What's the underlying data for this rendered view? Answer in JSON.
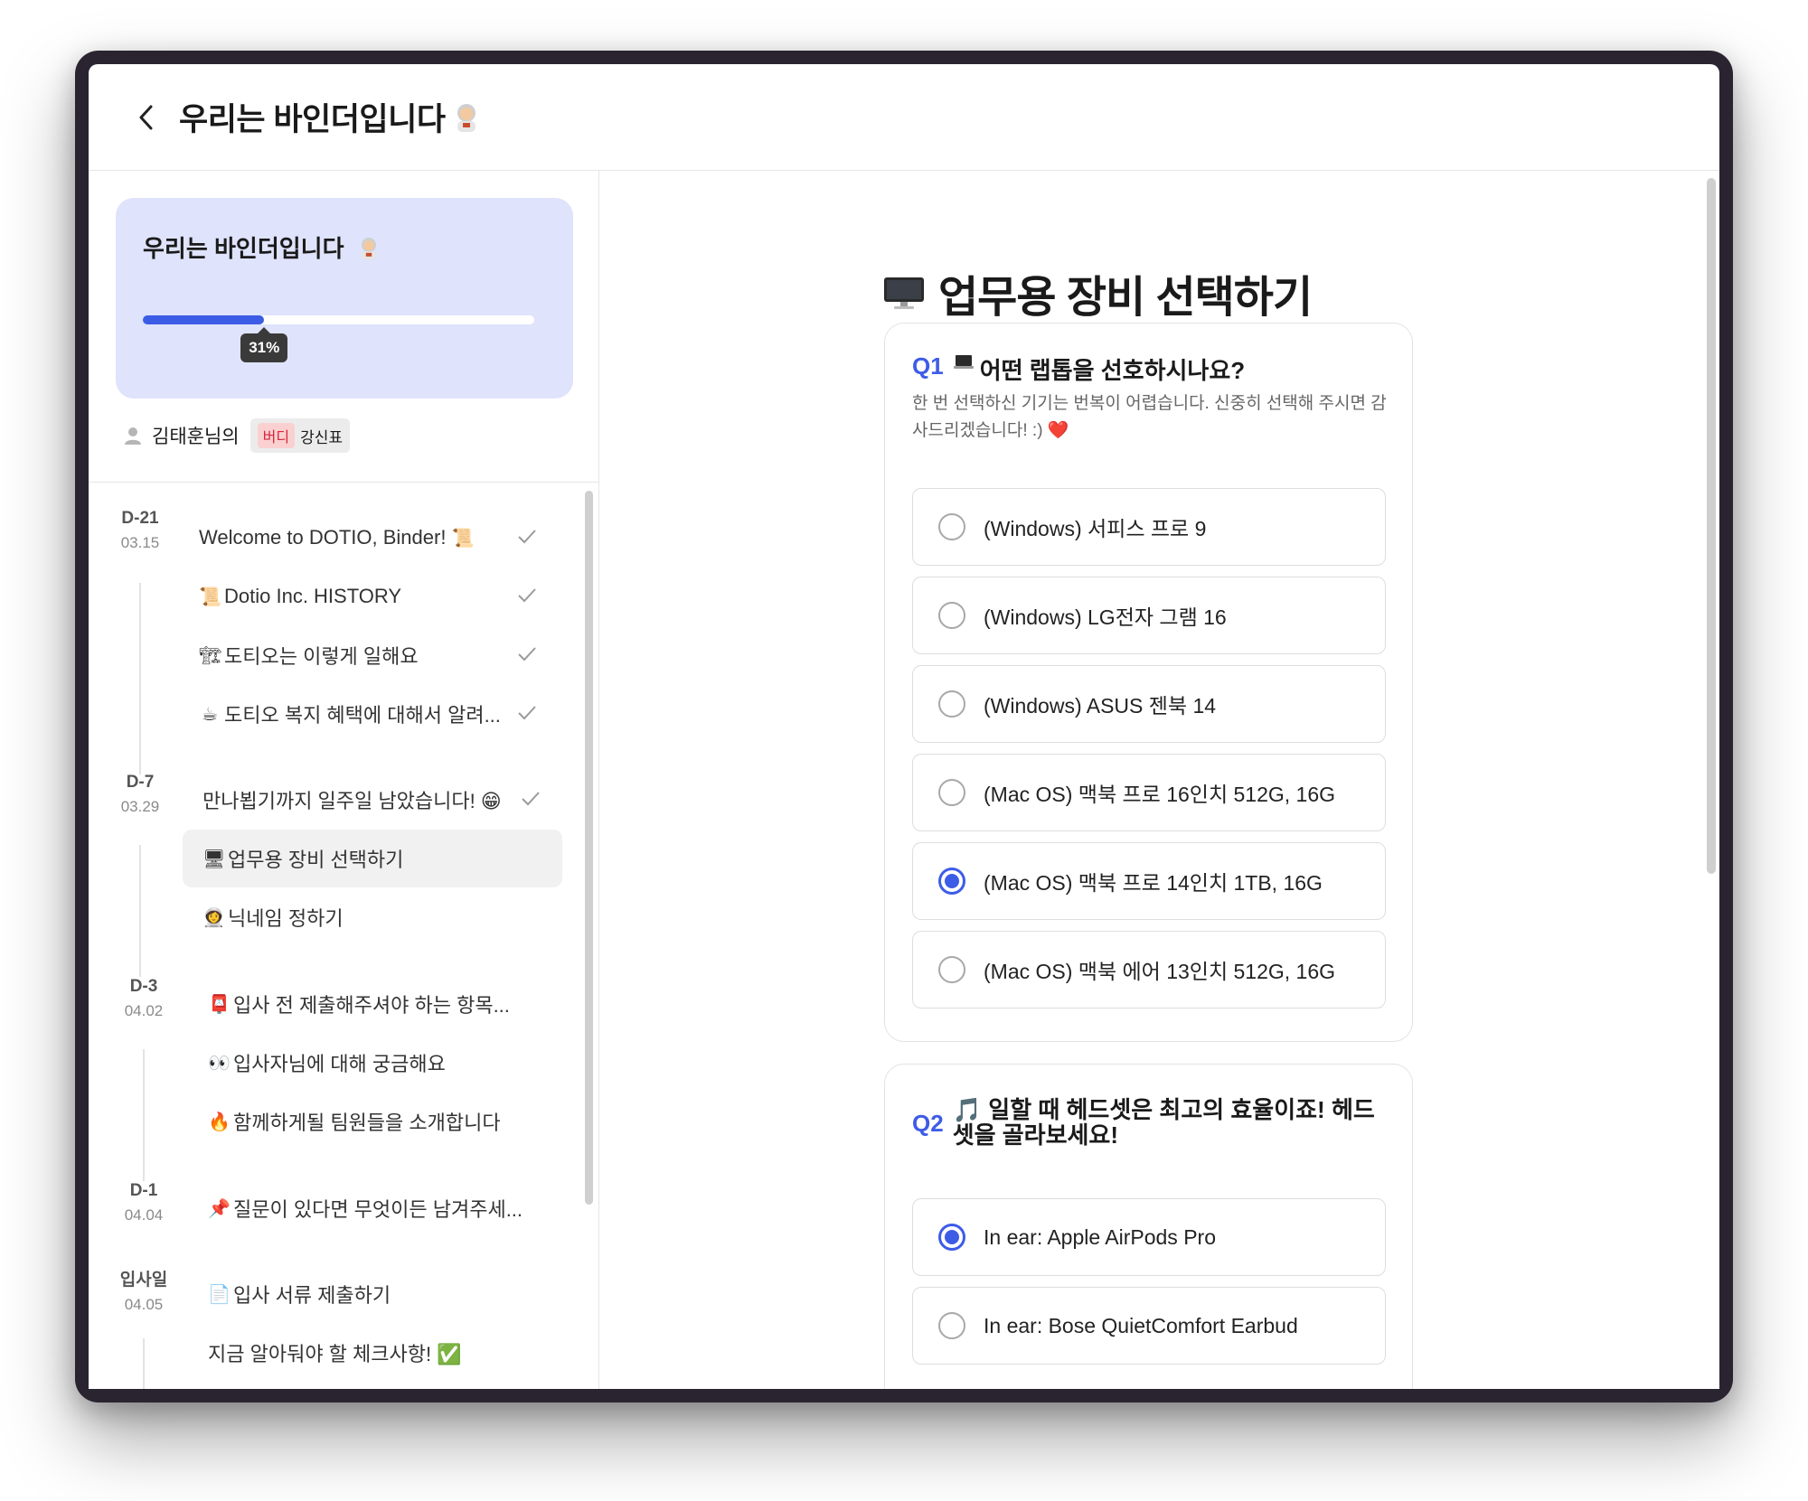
{
  "header": {
    "title": "우리는 바인더입니다"
  },
  "progress": {
    "title": "우리는 바인더입니다",
    "percent": 31,
    "percent_label": "31%"
  },
  "owner": {
    "name": "김태훈님의",
    "buddy_tag": "버디",
    "buddy_name": "강신표"
  },
  "timeline": {
    "days": [
      {
        "d": "D-21",
        "date": "03.15"
      },
      {
        "d": "D-7",
        "date": "03.29"
      },
      {
        "d": "D-3",
        "date": "04.02"
      },
      {
        "d": "D-1",
        "date": "04.04"
      },
      {
        "d": "입사일",
        "date": "04.05"
      }
    ],
    "items": [
      {
        "label": "Welcome to DOTIO, Binder!",
        "done": true
      },
      {
        "label": "Dotio Inc. HISTORY",
        "done": true
      },
      {
        "label": "도티오는 이렇게 일해요",
        "done": true
      },
      {
        "label": "도티오 복지 혜택에 대해서 알려...",
        "done": true
      },
      {
        "label": "만나뵙기까지 일주일 남았습니다! 😁",
        "done": true
      },
      {
        "label": "업무용 장비 선택하기",
        "done": false,
        "active": true
      },
      {
        "label": "닉네임 정하기",
        "done": false
      },
      {
        "label": "입사 전 제출해주셔야 하는 항목...",
        "done": false
      },
      {
        "label": "입사자님에 대해 궁금해요",
        "done": false
      },
      {
        "label": "함께하게될 팀원들을 소개합니다",
        "done": false
      },
      {
        "label": "질문이 있다면 무엇이든 남겨주세...",
        "done": false
      },
      {
        "label": "입사 서류 제출하기",
        "done": false
      },
      {
        "label": "지금 알아둬야 할 체크사항! ✅",
        "done": false
      }
    ],
    "icons": [
      "scroll-emoji-icon",
      "book-emoji-icon",
      "construction-emoji-icon",
      "coffee-emoji-icon",
      "",
      "monitor-emoji-icon",
      "astronaut-emoji-icon",
      "mailbox-emoji-icon",
      "eyes-emoji-icon",
      "fire-emoji-icon",
      "pushpin-emoji-icon",
      "page-emoji-icon",
      ""
    ]
  },
  "main": {
    "title": "업무용 장비 선택하기",
    "q1": {
      "num": "Q1",
      "title": "어떤 랩톱을 선호하시나요?",
      "desc": "한 번 선택하신 기기는 번복이 어렵습니다. 신중히 선택해 주시면 감사드리겠습니다! :) ❤️",
      "options": [
        "(Windows) 서피스 프로 9",
        "(Windows) LG전자 그램 16",
        "(Windows) ASUS 젠북 14",
        "(Mac OS) 맥북 프로 16인치 512G, 16G",
        "(Mac OS) 맥북 프로 14인치 1TB, 16G",
        "(Mac OS) 맥북 에어 13인치 512G, 16G"
      ],
      "selected_index": 4
    },
    "q2": {
      "num": "Q2",
      "title": "🎵 일할 때 헤드셋은 최고의 효율이죠! 헤드셋을 골라보세요!",
      "options": [
        "In ear: Apple AirPods Pro",
        "In ear: Bose QuietComfort Earbud"
      ],
      "selected_index": 0
    }
  },
  "colors": {
    "accent": "#3d5ce6",
    "card_bg": "#dfe3fb",
    "buddy_tag": "#d7263d"
  }
}
